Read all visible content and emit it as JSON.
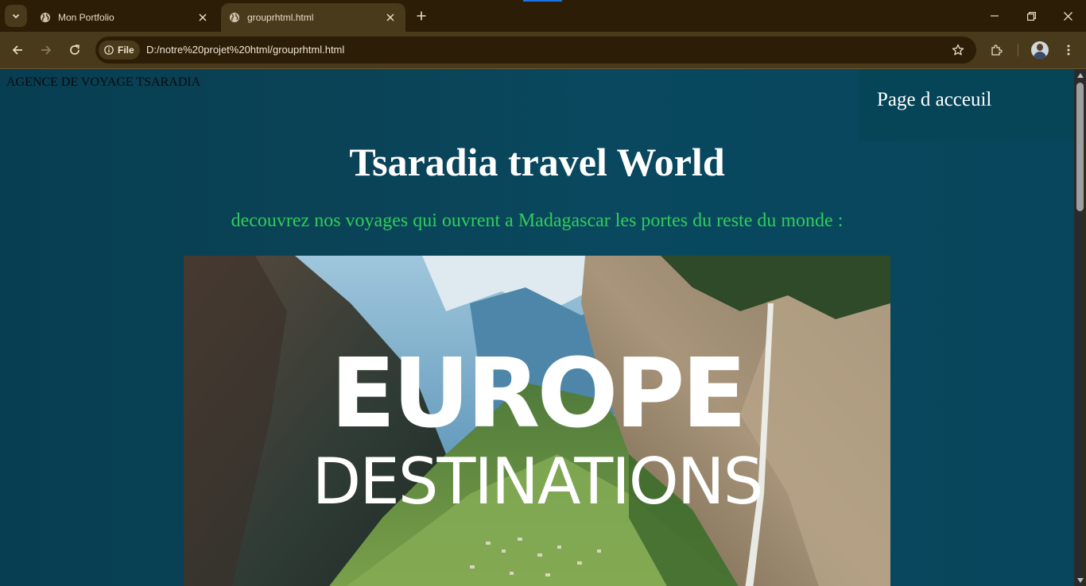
{
  "browser": {
    "tabs": [
      {
        "title": "Mon Portfolio",
        "active": false
      },
      {
        "title": "grouprhtml.html",
        "active": true
      }
    ],
    "url_chip": "File",
    "url": "D:/notre%20projet%20html/grouprhtml.html",
    "accent_color": "#1a73e8"
  },
  "page": {
    "brand": "AGENCE DE VOYAGE TSARADIA",
    "nav_link": "Page d acceuil",
    "hero_title": "Tsaradia travel World",
    "tagline": "decouvrez nos voyages qui ouvrent a Madagascar les portes du reste du monde :",
    "banner": {
      "title": "EUROPE",
      "subtitle": "DESTINATIONS"
    },
    "colors": {
      "background": "#07465c",
      "tagline": "#2fce5a"
    }
  }
}
